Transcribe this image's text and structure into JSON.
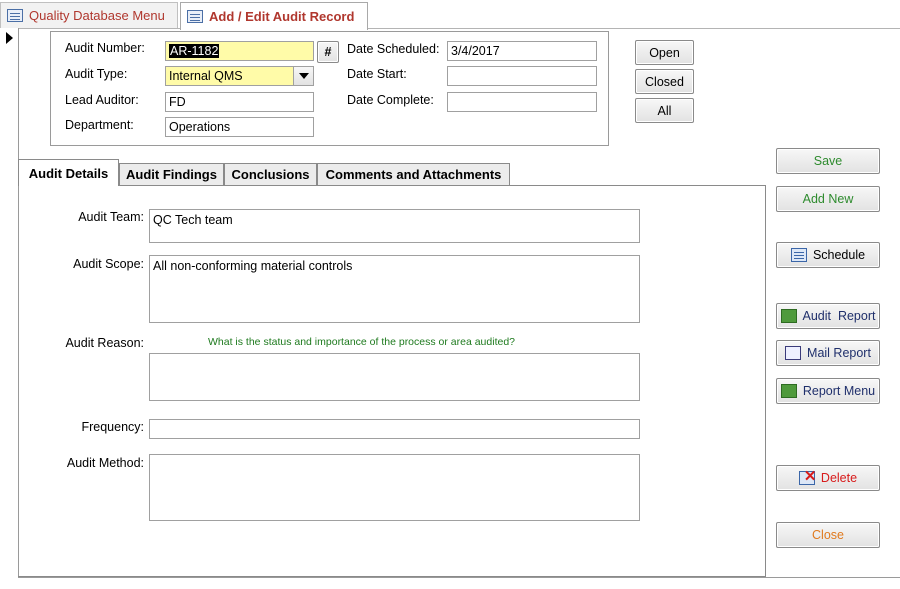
{
  "doc_tabs": [
    {
      "label": "Quality Database Menu",
      "active": false
    },
    {
      "label": "Add / Edit Audit Record",
      "active": true
    }
  ],
  "header": {
    "audit_number_label": "Audit Number:",
    "audit_number_value": "AR-1182",
    "hash_button": "#",
    "audit_type_label": "Audit Type:",
    "audit_type_value": "Internal QMS",
    "lead_auditor_label": "Lead Auditor:",
    "lead_auditor_value": "FD",
    "department_label": "Department:",
    "department_value": "Operations",
    "date_scheduled_label": "Date Scheduled:",
    "date_scheduled_value": "3/4/2017",
    "date_start_label": "Date Start:",
    "date_start_value": "",
    "date_complete_label": "Date Complete:",
    "date_complete_value": ""
  },
  "filter_buttons": {
    "open": "Open",
    "closed": "Closed",
    "all": "All"
  },
  "form_tabs": [
    {
      "label": "Audit Details",
      "active": true
    },
    {
      "label": "Audit Findings",
      "active": false
    },
    {
      "label": "Conclusions",
      "active": false
    },
    {
      "label": "Comments and Attachments",
      "active": false
    }
  ],
  "details": {
    "audit_team_label": "Audit Team:",
    "audit_team_value": "QC Tech team",
    "audit_scope_label": "Audit Scope:",
    "audit_scope_value": "All non-conforming material controls",
    "audit_reason_label": "Audit Reason:",
    "audit_reason_hint": "What is the status and importance of the process or area audited?",
    "audit_reason_value": "",
    "frequency_label": "Frequency:",
    "frequency_value": "",
    "audit_method_label": "Audit Method:",
    "audit_method_value": ""
  },
  "actions": {
    "save": "Save",
    "add_new": "Add New",
    "schedule": "Schedule",
    "audit_report": "Audit  Report",
    "mail_report": "Mail Report",
    "report_menu": "Report Menu",
    "delete": "Delete",
    "close": "Close"
  },
  "colors": {
    "doc_tab_text": "#b0372e",
    "highlight_field": "#fffba8",
    "hint_text": "#1e7a1e",
    "save_text": "#2e8b2e",
    "delete_text": "#d81b1b",
    "close_text": "#e07a1f"
  },
  "icons": [
    "form-icon",
    "record-selector-icon",
    "dropdown-arrow-icon",
    "schedule-icon",
    "audit-report-icon",
    "mail-report-icon",
    "report-menu-icon",
    "delete-icon"
  ]
}
